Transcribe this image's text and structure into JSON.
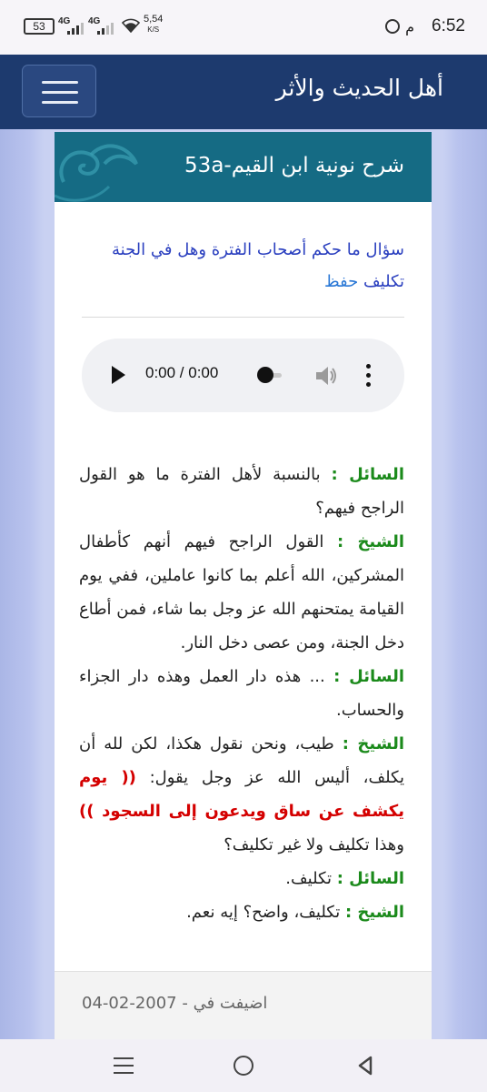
{
  "status_bar": {
    "time": "6:52",
    "am_pm": "م",
    "battery": "53",
    "network_1": "4G",
    "network_2": "4G",
    "speed_value": "5,54",
    "speed_unit": "K/S"
  },
  "navbar": {
    "brand": "أهل الحديث والأثر",
    "menu_icon": "hamburger-icon"
  },
  "card": {
    "title": "شرح نونية ابن القيم-53a",
    "question": "سؤال ما حكم أصحاب الفترة وهل في الجنة تكليف",
    "save_label": "حفظ",
    "audio": {
      "time_display": "0:00 / 0:00",
      "progress": 0
    },
    "dialog": [
      {
        "speaker": "السائل :",
        "text": " بالنسبة لأهل الفترة ما هو القول الراجح فيهم؟"
      },
      {
        "speaker": "الشيخ :",
        "text": " القول الراجح فيهم أنهم كأطفال المشركين، الله أعلم بما كانوا عاملين، ففي يوم القيامة يمتحنهم الله عز وجل بما شاء، فمن أطاع دخل الجنة، ومن عصى دخل النار."
      },
      {
        "speaker": "السائل :",
        "text": " ... هذه دار العمل وهذه دار الجزاء والحساب."
      },
      {
        "speaker": "الشيخ :",
        "text": " طيب، ونحن نقول هكذا، لكن لله أن يكلف، أليس الله عز وجل يقول: ",
        "verse": "(( يوم يكشف عن ساق ويدعون إلى السجود ))",
        "after": " وهذا تكليف ولا غير تكليف؟"
      },
      {
        "speaker": "السائل :",
        "text": " تكليف."
      },
      {
        "speaker": "الشيخ :",
        "text": " تكليف، واضح؟ إيه نعم."
      }
    ],
    "footer": {
      "added_label": "اضيفت في - ",
      "added_date": "2007-02-04"
    }
  },
  "colors": {
    "navbar": "#1d3a6e",
    "card_header": "#156b84",
    "speaker": "#1b8a1b",
    "verse": "#d40000",
    "question": "#2a3fbf"
  }
}
